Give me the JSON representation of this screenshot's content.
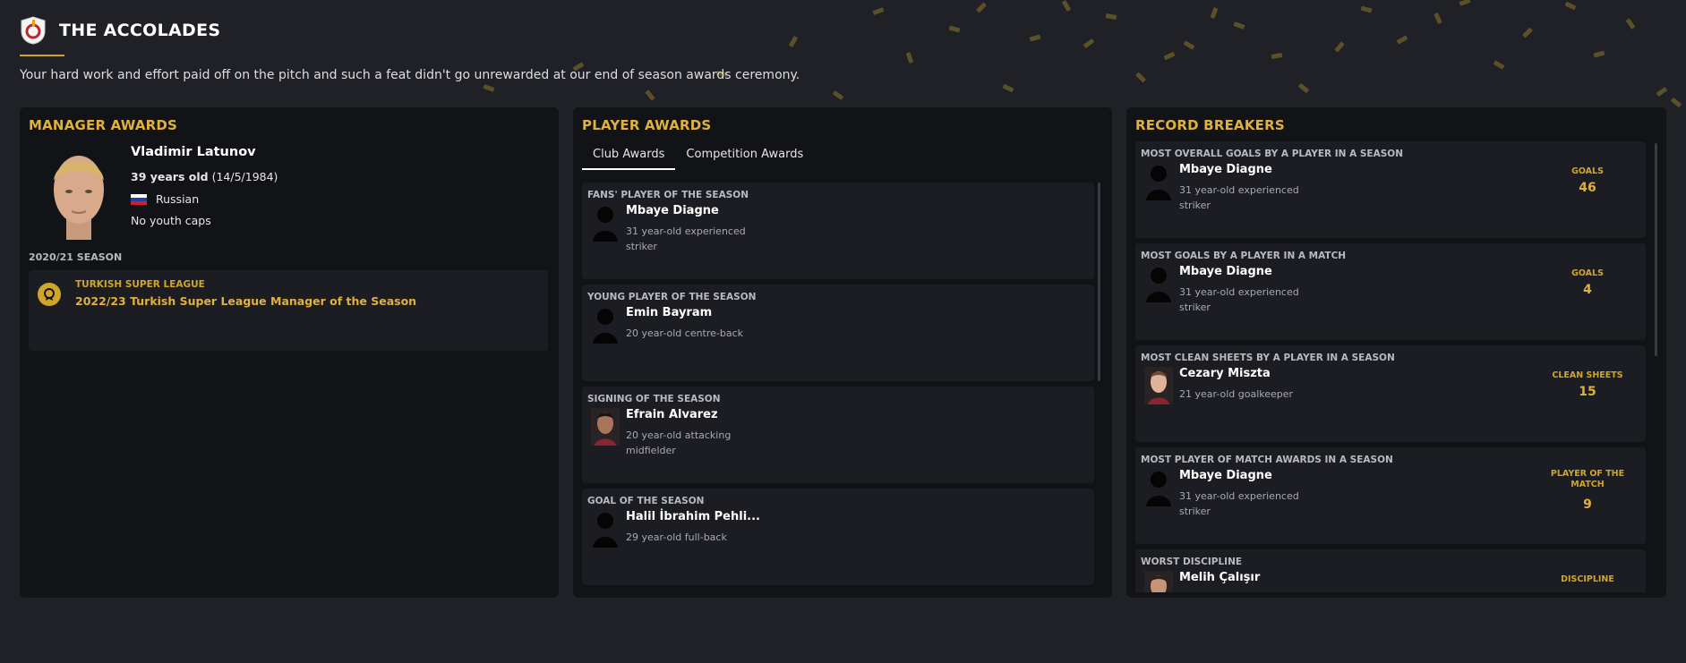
{
  "header": {
    "title": "THE ACCOLADES",
    "intro": "Your hard work and effort paid off on the pitch and such a feat didn't go unrewarded at our end of season awards ceremony."
  },
  "manager_awards": {
    "title": "MANAGER AWARDS",
    "name": "Vladimir Latunov",
    "age": "39 years old",
    "dob": "(14/5/1984)",
    "nationality": "Russian",
    "caps": "No youth caps",
    "season": "2020/21 SEASON",
    "awards": [
      {
        "competition": "TURKISH SUPER LEAGUE",
        "name": "2022/23 Turkish Super League Manager of the Season"
      }
    ]
  },
  "player_awards": {
    "title": "PLAYER AWARDS",
    "tabs": [
      "Club Awards",
      "Competition Awards"
    ],
    "active_tab": "Club Awards",
    "items": [
      {
        "category": "FANS' PLAYER OF THE SEASON",
        "name": "Mbaye Diagne",
        "desc": "31 year-old experienced striker"
      },
      {
        "category": "YOUNG PLAYER OF THE SEASON",
        "name": "Emin Bayram",
        "desc": "20 year-old centre-back"
      },
      {
        "category": "SIGNING OF THE SEASON",
        "name": "Efrain Alvarez",
        "desc": "20 year-old attacking midfielder"
      },
      {
        "category": "GOAL OF THE SEASON",
        "name": "Halil İbrahim Pehli...",
        "desc": "29 year-old full-back"
      }
    ]
  },
  "record_breakers": {
    "title": "RECORD BREAKERS",
    "items": [
      {
        "category": "MOST OVERALL GOALS BY A PLAYER IN A SEASON",
        "name": "Mbaye Diagne",
        "desc": "31 year-old experienced striker",
        "stat_label": "GOALS",
        "stat_value": "46"
      },
      {
        "category": "MOST GOALS BY A PLAYER IN A MATCH",
        "name": "Mbaye Diagne",
        "desc": "31 year-old experienced striker",
        "stat_label": "GOALS",
        "stat_value": "4"
      },
      {
        "category": "MOST CLEAN SHEETS BY A PLAYER IN A SEASON",
        "name": "Cezary Miszta",
        "desc": "21 year-old goalkeeper",
        "stat_label": "CLEAN SHEETS",
        "stat_value": "15"
      },
      {
        "category": "MOST PLAYER OF MATCH AWARDS IN A SEASON",
        "name": "Mbaye Diagne",
        "desc": "31 year-old experienced striker",
        "stat_label": "PLAYER OF THE MATCH",
        "stat_value": "9"
      },
      {
        "category": "WORST DISCIPLINE",
        "name": "Melih Çalışır",
        "desc": "",
        "stat_label": "DISCIPLINE",
        "stat_value": ""
      }
    ]
  },
  "colors": {
    "accent": "#e0b13c",
    "panel": "#121317",
    "card": "#1c1d22",
    "background": "#1f2126"
  }
}
